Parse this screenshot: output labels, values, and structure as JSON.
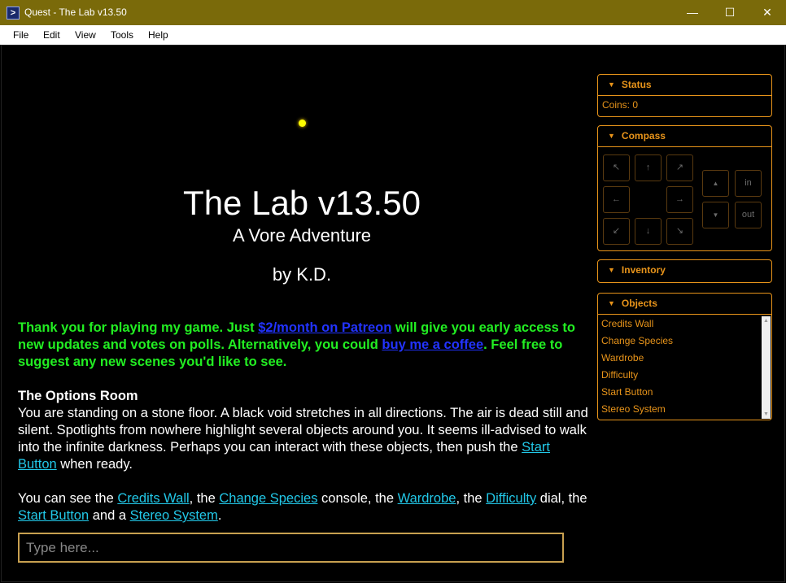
{
  "window": {
    "title": "Quest - The Lab v13.50",
    "minimize": "—",
    "maximize": "☐",
    "close": "✕"
  },
  "menu": [
    "File",
    "Edit",
    "View",
    "Tools",
    "Help"
  ],
  "game": {
    "title": "The Lab v13.50",
    "subtitle": "A Vore Adventure",
    "author": "by K.D.",
    "promo": {
      "part1": "Thank you for playing my game. Just ",
      "link1": "$2/month on Patreon",
      "part2": " will give you early access to new updates and votes on polls. Alternatively, you could ",
      "link2": "buy me a coffee",
      "part3": ". Feel free to suggest any new scenes you'd like to see."
    },
    "room_name": "The Options Room",
    "room_desc": {
      "text": "You are standing on a stone floor. A black void stretches in all directions. The air is dead still and silent. Spotlights from nowhere highlight several objects around you. It seems ill-advised to walk into the infinite darkness. Perhaps you can interact with these objects, then push the ",
      "link": "Start Button",
      "end": " when ready."
    },
    "room_objects": {
      "t1": "You can see the ",
      "l1": "Credits Wall",
      "t2": ", the ",
      "l2": "Change Species",
      "t3": " console, the ",
      "l3": "Wardrobe",
      "t4": ", the ",
      "l4": "Difficulty",
      "t5": " dial, the ",
      "l5": "Start Button",
      "t6": " and a ",
      "l6": "Stereo System",
      "t7": "."
    },
    "input_placeholder": "Type here..."
  },
  "sidebar": {
    "status": {
      "label": "Status",
      "coins": "Coins: 0"
    },
    "compass": {
      "label": "Compass",
      "nw": "↖",
      "n": "↑",
      "ne": "↗",
      "w": "←",
      "e": "→",
      "sw": "↙",
      "s": "↓",
      "se": "↘",
      "up": "▲",
      "in": "in",
      "down": "▼",
      "out": "out"
    },
    "inventory": {
      "label": "Inventory"
    },
    "objects": {
      "label": "Objects",
      "items": [
        "Credits Wall",
        "Change Species",
        "Wardrobe",
        "Difficulty",
        "Start Button",
        "Stereo System"
      ]
    }
  },
  "colors": {
    "titlebar": "#7a6a0a",
    "panel_accent": "#e8941a",
    "promo_green": "#22ee22",
    "link_cyan": "#22c8e8"
  }
}
